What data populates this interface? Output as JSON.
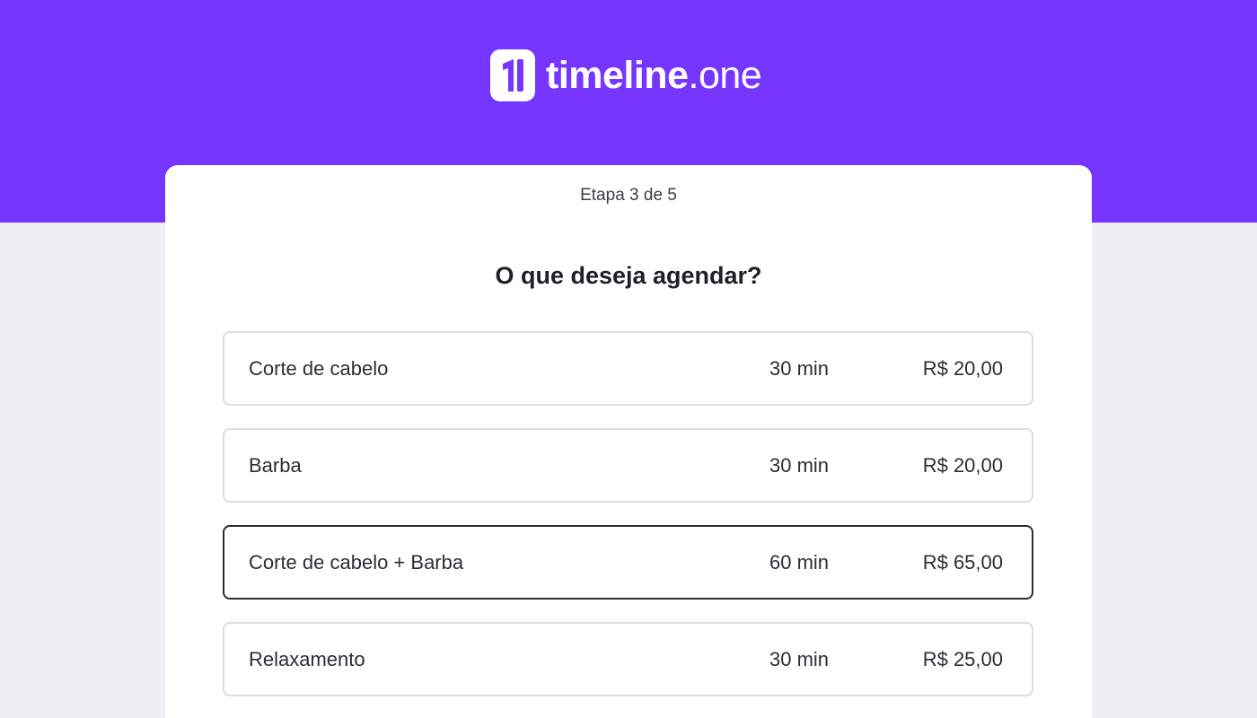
{
  "brand": {
    "name_bold": "timeline",
    "name_light": ".one",
    "header_color": "#7636ff",
    "logo_icon": "timeline-one-logo-icon"
  },
  "step_label": "Etapa 3 de 5",
  "question": "O que deseja agendar?",
  "services": [
    {
      "name": "Corte de cabelo",
      "duration": "30 min",
      "price": "R$ 20,00",
      "selected": false
    },
    {
      "name": "Barba",
      "duration": "30 min",
      "price": "R$ 20,00",
      "selected": false
    },
    {
      "name": "Corte de cabelo + Barba",
      "duration": "60 min",
      "price": "R$ 65,00",
      "selected": true
    },
    {
      "name": "Relaxamento",
      "duration": "30 min",
      "price": "R$ 25,00",
      "selected": false
    }
  ]
}
